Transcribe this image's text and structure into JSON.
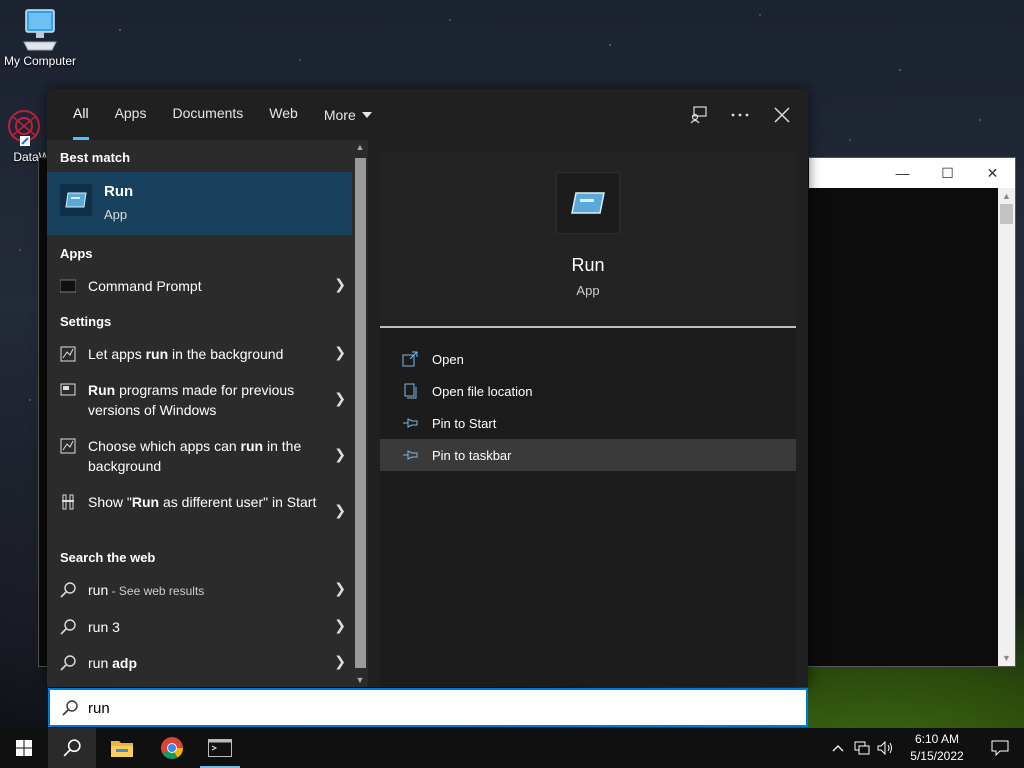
{
  "desktop": {
    "icons": [
      {
        "label": "My Computer"
      },
      {
        "label": "DataW"
      }
    ]
  },
  "tabs": [
    {
      "label": "All"
    },
    {
      "label": "Apps"
    },
    {
      "label": "Documents"
    },
    {
      "label": "Web"
    },
    {
      "label": "More"
    }
  ],
  "results": {
    "best_match_title": "Best match",
    "best_match": {
      "name": "Run",
      "type": "App"
    },
    "apps_title": "Apps",
    "apps": [
      {
        "label": "Command Prompt"
      }
    ],
    "settings_title": "Settings",
    "settings": [
      {
        "pre": "Let apps ",
        "bold": "run",
        "post": " in the background"
      },
      {
        "pre": "",
        "bold": "Run",
        "post": " programs made for previous versions of Windows"
      },
      {
        "pre": "Choose which apps can ",
        "bold": "run",
        "post": " in the background"
      },
      {
        "pre": "Show \"",
        "bold": "Run",
        "post": " as different user\" in Start"
      }
    ],
    "web_title": "Search the web",
    "web": [
      {
        "main": "run",
        "sub": " - See web results"
      },
      {
        "main": "run 3",
        "sub": ""
      },
      {
        "main": "run ",
        "bold": "adp",
        "sub": ""
      }
    ]
  },
  "detail": {
    "name": "Run",
    "type": "App",
    "actions": [
      {
        "label": "Open"
      },
      {
        "label": "Open file location"
      },
      {
        "label": "Pin to Start"
      },
      {
        "label": "Pin to taskbar"
      }
    ]
  },
  "search": {
    "value": "run"
  },
  "taskbar": {
    "time": "6:10 AM",
    "date": "5/15/2022"
  },
  "colors": {
    "accent": "#4cc2ff",
    "best_match_bg": "#18415e",
    "search_border": "#0078d7"
  }
}
